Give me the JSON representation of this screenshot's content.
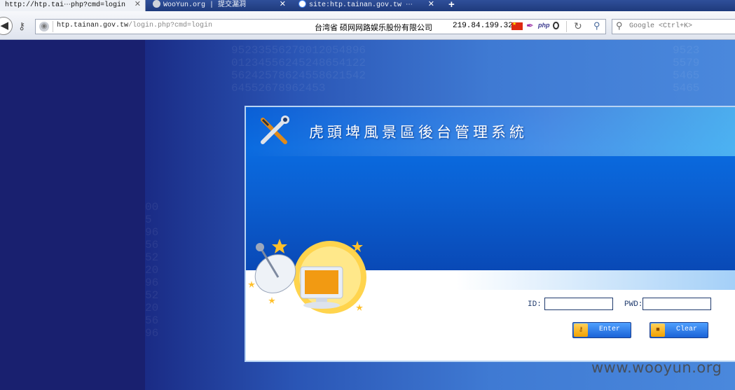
{
  "browser": {
    "tabs": [
      {
        "title": "http://htp.tai⋯php?cmd=login",
        "active": true
      },
      {
        "title": "WooYun.org | 提交漏洞",
        "active": false
      },
      {
        "title": "site:htp.tainan.gov.tw ⋯",
        "active": false
      }
    ],
    "new_tab_label": "+",
    "url_domain": "htp.tainan.gov.tw",
    "url_path": "/login.php?cmd=login",
    "isp_location": "台湾省 硕网网路娱乐股份有限公司",
    "server_ip": "219.84.199.32",
    "php_badge": "php",
    "search_placeholder": "Google <Ctrl+K>"
  },
  "icons": [
    "back-icon",
    "key-icon",
    "globe-icon",
    "flag-cn-icon",
    "feather-icon",
    "opera-icon",
    "reload-icon",
    "search-icon",
    "tools-icon",
    "satellite-dish-icon"
  ],
  "login_panel": {
    "system_title": "虎頭埤風景區後台管理系統",
    "id_label": "ID:",
    "pwd_label": "PWD:",
    "id_value": "",
    "pwd_value": "",
    "enter_label": "Enter",
    "clear_label": "Clear"
  },
  "watermark": "www.wooyun.org",
  "colors": {
    "accent": "#0a5fd6",
    "background": "#19206f"
  }
}
